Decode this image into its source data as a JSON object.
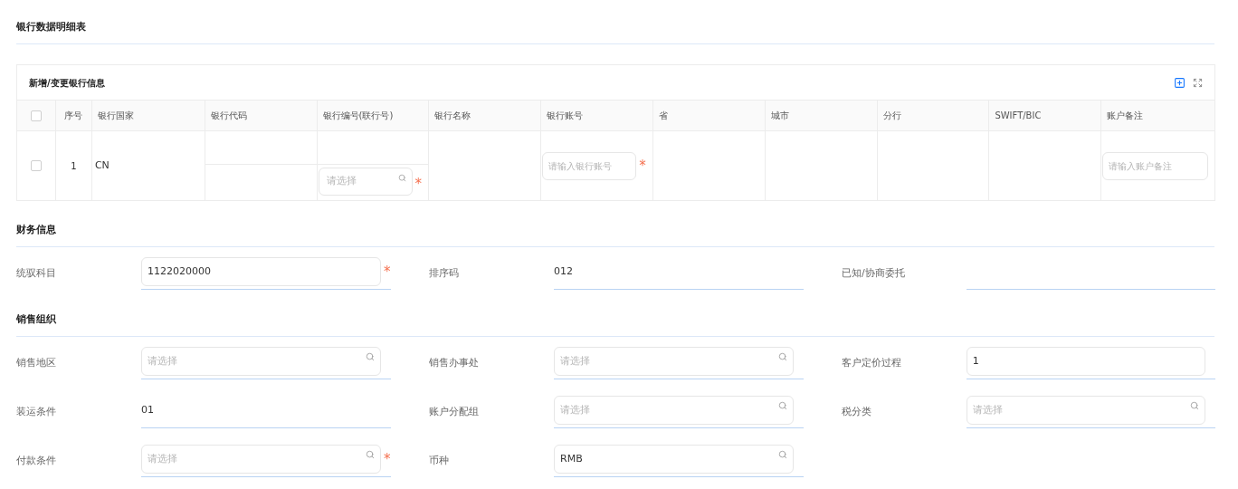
{
  "page_title": "银行数据明细表",
  "bank_table": {
    "title": "新增/变更银行信息",
    "columns": [
      "序号",
      "银行国家",
      "银行代码",
      "银行编号(联行号)",
      "银行名称",
      "银行账号",
      "省",
      "城市",
      "分行",
      "SWIFT/BIC",
      "账户备注"
    ],
    "header_checked": false,
    "rows": [
      {
        "checked": false,
        "index": "1",
        "country": "CN",
        "bank_number": {
          "placeholder": "请选择",
          "required_mark": "*"
        },
        "account": {
          "placeholder": "请输入银行账号",
          "required_mark": "*"
        },
        "remark": {
          "placeholder": "请输入账户备注"
        }
      }
    ]
  },
  "sections": [
    {
      "title": "财务信息",
      "fields": [
        {
          "label": "统驭科目",
          "kind": "input",
          "value": "1122020000",
          "required_mark": "*"
        },
        {
          "label": "排序码",
          "kind": "text",
          "value": "012"
        },
        {
          "label": "已知/协商委托",
          "kind": "text"
        }
      ]
    },
    {
      "title": "销售组织",
      "fields": [
        {
          "label": "销售地区",
          "kind": "select",
          "placeholder": "请选择"
        },
        {
          "label": "销售办事处",
          "kind": "select",
          "placeholder": "请选择"
        },
        {
          "label": "客户定价过程",
          "kind": "input",
          "value": "1"
        },
        {
          "label": "装运条件",
          "kind": "text",
          "value": "01"
        },
        {
          "label": "账户分配组",
          "kind": "select",
          "placeholder": "请选择"
        },
        {
          "label": "税分类",
          "kind": "select",
          "placeholder": "请选择"
        },
        {
          "label": "付款条件",
          "kind": "select",
          "placeholder": "请选择",
          "required_mark": "*"
        },
        {
          "label": "币种",
          "kind": "select",
          "value": "RMB"
        }
      ]
    }
  ]
}
